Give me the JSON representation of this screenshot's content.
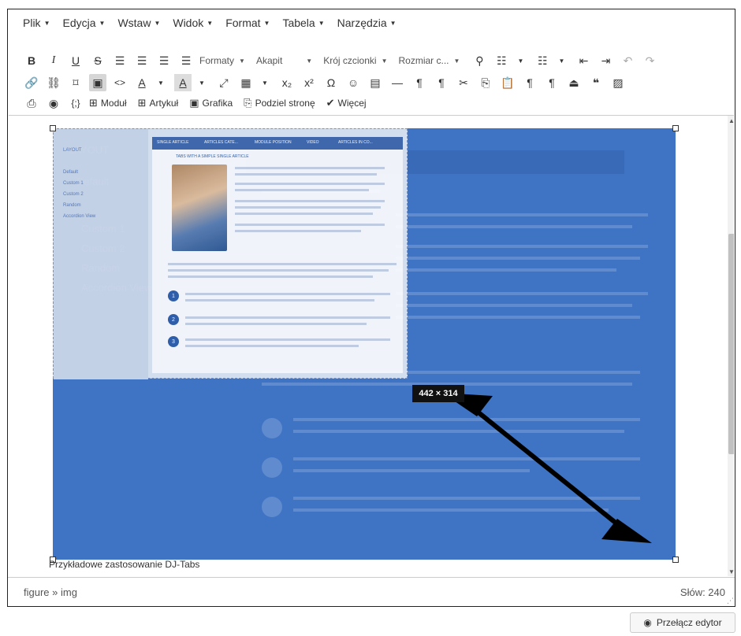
{
  "menubar": {
    "items": [
      {
        "label": "Plik"
      },
      {
        "label": "Edycja"
      },
      {
        "label": "Wstaw"
      },
      {
        "label": "Widok"
      },
      {
        "label": "Format"
      },
      {
        "label": "Tabela"
      },
      {
        "label": "Narzędzia"
      }
    ]
  },
  "toolbar": {
    "row1": {
      "bold": "B",
      "italic": "I",
      "underline": "U",
      "strikethrough": "S",
      "formats_label": "Formaty",
      "paragraph_label": "Akapit",
      "font_label": "Krój czcionki",
      "size_label": "Rozmiar c..."
    },
    "row2": {
      "code_label": "<>",
      "subscript": "x₂",
      "superscript": "x²",
      "omega": "Ω"
    },
    "row3": {
      "source_code": "{;}",
      "module_label": "Moduł",
      "article_label": "Artykuł",
      "image_label": "Grafika",
      "pagebreak_label": "Podziel stronę",
      "more_label": "Więcej"
    }
  },
  "image": {
    "size_label": "442 × 314",
    "preview_title": "TABS WITH A SIMPLE SINGLE ARTICLE",
    "preview_tabs": [
      "SINGLE ARTICLE",
      "ARTICLES CATE...",
      "MODULE POSITION",
      "VIDEO",
      "ARTICLES IN CO..."
    ],
    "ghost_menu": [
      "LAYOUT",
      "Default",
      "Custom 1",
      "Custom 2",
      "Random",
      "Accordion View"
    ],
    "numbers": [
      "1",
      "2",
      "3"
    ]
  },
  "caption": "Przykładowe zastosowanie DJ-Tabs",
  "statusbar": {
    "path": "figure » img",
    "word_count": "Słów: 240"
  },
  "toggle_editor_label": "Przełącz edytor"
}
